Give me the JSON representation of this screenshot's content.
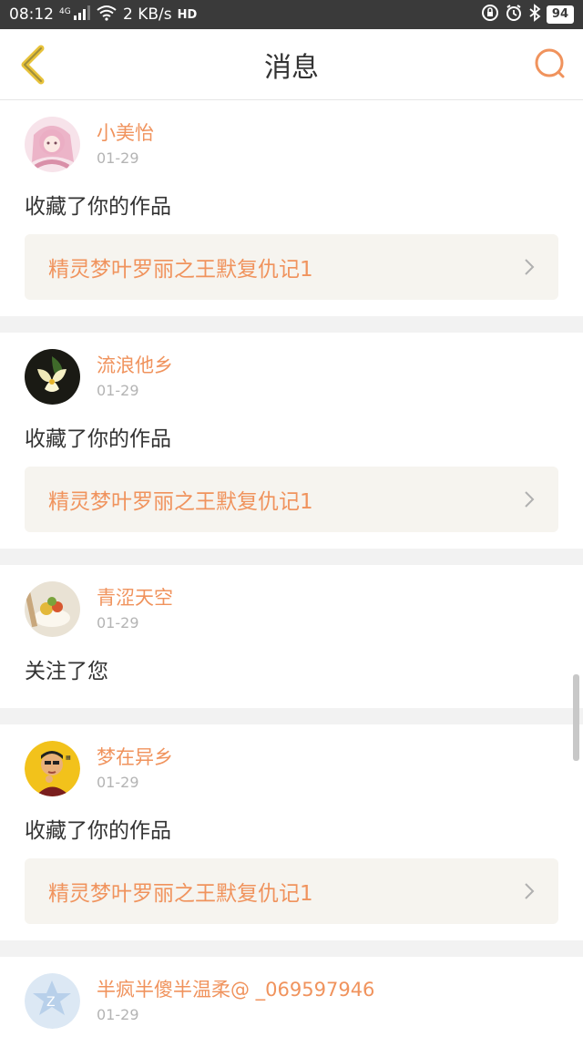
{
  "status_bar": {
    "time": "08:12",
    "network": "4G",
    "speed": "2 KB/s",
    "hd": "HD",
    "battery": "94"
  },
  "header": {
    "title": "消息"
  },
  "messages": [
    {
      "username": "小美怡",
      "date": "01-29",
      "action": "收藏了你的作品",
      "work_title": "精灵梦叶罗丽之王默复仇记1"
    },
    {
      "username": "流浪他乡",
      "date": "01-29",
      "action": "收藏了你的作品",
      "work_title": "精灵梦叶罗丽之王默复仇记1"
    },
    {
      "username": "青涩天空",
      "date": "01-29",
      "action": "关注了您"
    },
    {
      "username": "梦在异乡",
      "date": "01-29",
      "action": "收藏了你的作品",
      "work_title": "精灵梦叶罗丽之王默复仇记1"
    },
    {
      "username": "半疯半傻半温柔@ _069597946",
      "date": "01-29"
    }
  ],
  "colors": {
    "accent": "#f0935d",
    "status_bar_bg": "#3a3a3a",
    "link_bg": "#f6f4ef"
  }
}
